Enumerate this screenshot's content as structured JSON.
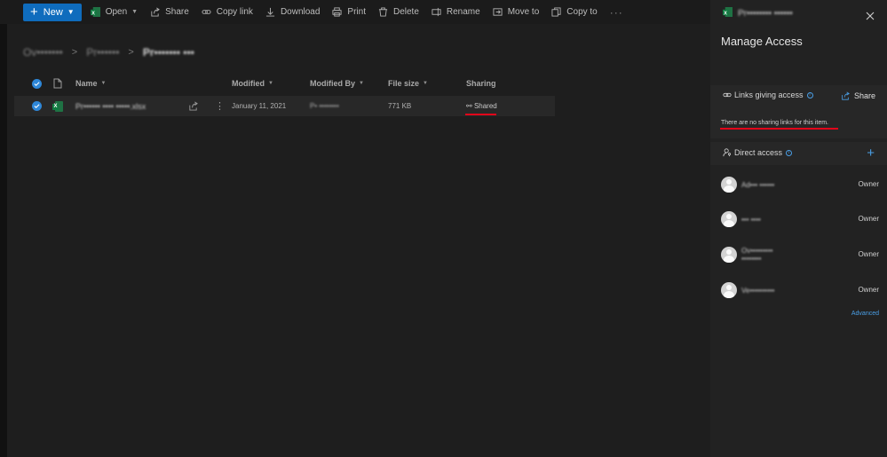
{
  "toolbar": {
    "new_label": "New",
    "commands": [
      {
        "label": "Open",
        "icon": "excel-icon",
        "has_chevron": true
      },
      {
        "label": "Share",
        "icon": "share-icon"
      },
      {
        "label": "Copy link",
        "icon": "link-icon"
      },
      {
        "label": "Download",
        "icon": "download-icon"
      },
      {
        "label": "Print",
        "icon": "print-icon"
      },
      {
        "label": "Delete",
        "icon": "trash-icon"
      },
      {
        "label": "Rename",
        "icon": "rename-icon"
      },
      {
        "label": "Move to",
        "icon": "move-icon"
      },
      {
        "label": "Copy to",
        "icon": "copy-icon"
      }
    ],
    "more_label": "···"
  },
  "breadcrumb": {
    "items": [
      "Ov•••••••",
      "Pr••••••"
    ],
    "current": "Pr••••••• •••"
  },
  "table": {
    "headers": {
      "name": "Name",
      "modified": "Modified",
      "modified_by": "Modified By",
      "file_size": "File size",
      "sharing": "Sharing"
    },
    "rows": [
      {
        "name": "Pr•••••• •••• •••••.xlsx",
        "modified": "January 11, 2021",
        "modified_by": "P• ••••••••",
        "file_size": "771 KB",
        "sharing": "Shared"
      }
    ]
  },
  "panel": {
    "file_name": "Pr•••••••• ••••••",
    "title": "Manage Access",
    "links_label": "Links giving access",
    "share_label": "Share",
    "no_links_text": "There are no sharing links for this item.",
    "direct_label": "Direct access",
    "people": [
      {
        "name": "Ad••• ••••••",
        "role": "Owner"
      },
      {
        "name": "••• ••••",
        "role": "Owner"
      },
      {
        "name": "Ov•••••••••",
        "name2": "••••••••",
        "role": "Owner"
      },
      {
        "name": "Ve••••••••••",
        "role": "Owner"
      }
    ],
    "advanced_label": "Advanced"
  },
  "colors": {
    "accent": "#0f6cbd",
    "link_blue": "#4a9fe6",
    "annotation_red": "#e1061a",
    "excel_green": "#107c41"
  }
}
